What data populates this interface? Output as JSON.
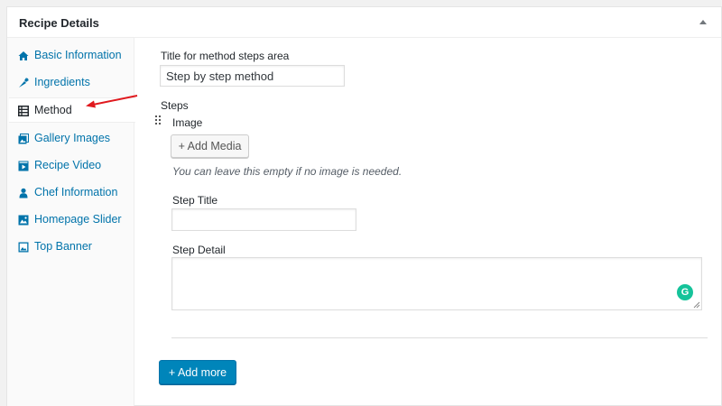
{
  "metabox": {
    "title": "Recipe Details"
  },
  "sidebar": {
    "active_tab": "Method",
    "tabs": [
      {
        "label": "Basic Information",
        "icon": "home-icon"
      },
      {
        "label": "Ingredients",
        "icon": "carrot-icon"
      },
      {
        "label": "Method",
        "icon": "list-view-icon"
      },
      {
        "label": "Gallery Images",
        "icon": "gallery-icon"
      },
      {
        "label": "Recipe Video",
        "icon": "video-icon"
      },
      {
        "label": "Chef Information",
        "icon": "user-icon"
      },
      {
        "label": "Homepage Slider",
        "icon": "slider-icon"
      },
      {
        "label": "Top Banner",
        "icon": "image-icon"
      }
    ]
  },
  "method": {
    "title_label": "Title for method steps area",
    "title_value": "Step by step method",
    "steps_label": "Steps",
    "image_label": "Image",
    "add_media_label": "+ Add Media",
    "image_hint": "You can leave this empty if no image is needed.",
    "step_title_label": "Step Title",
    "step_title_value": "",
    "step_detail_label": "Step Detail",
    "step_detail_value": "",
    "add_more_label": "+ Add more"
  },
  "colors": {
    "link": "#0073aa",
    "primary_button": "#0085ba",
    "annotation_arrow": "#e0191e",
    "grammarly": "#15c39a"
  }
}
